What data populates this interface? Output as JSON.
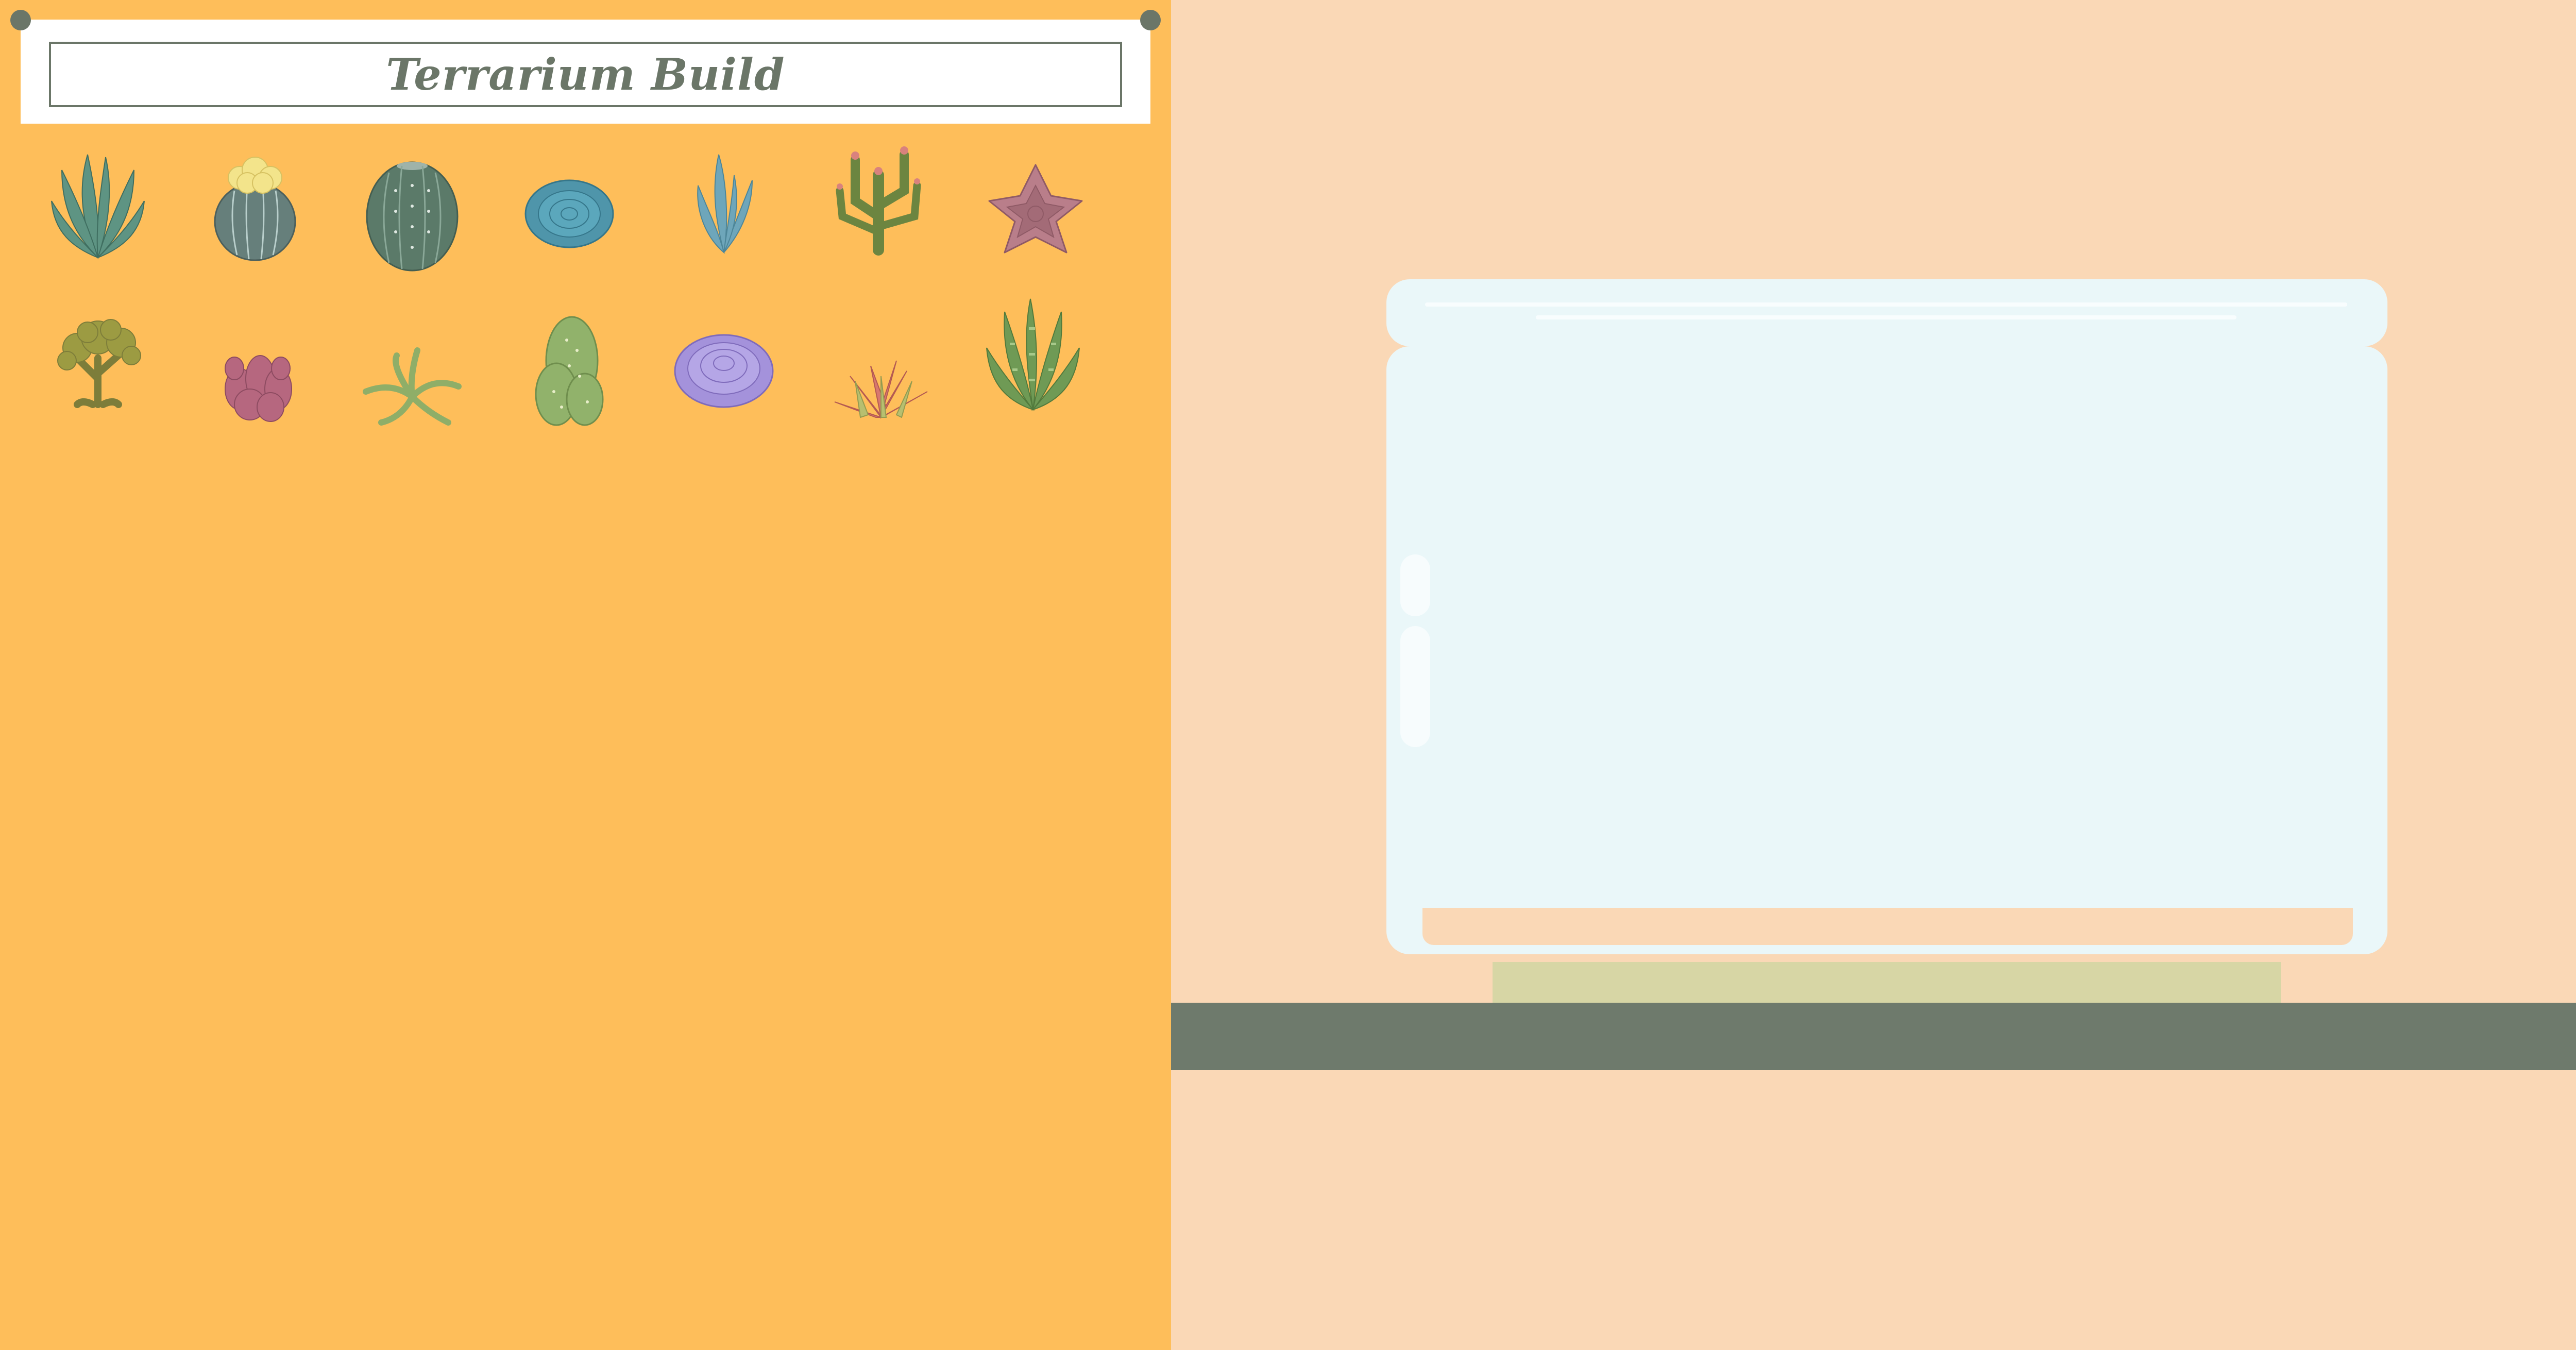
{
  "header": {
    "title": "Terrarium Build"
  },
  "colors": {
    "left_panel": "#FEBE5A",
    "right_panel": "#FAD8B6",
    "title_text": "#6B7668",
    "jar_glass": "#EAF7F9",
    "jar_base": "#D7D6A5",
    "shelf": "#6E7A6C"
  },
  "plants": [
    {
      "id": "plant1",
      "icon": "aloe-icon"
    },
    {
      "id": "plant2",
      "icon": "flowering-barrel-cactus-icon"
    },
    {
      "id": "plant3",
      "icon": "barrel-cactus-icon"
    },
    {
      "id": "plant4",
      "icon": "blue-rosette-succulent-icon"
    },
    {
      "id": "plant5",
      "icon": "blue-finger-succulent-icon"
    },
    {
      "id": "plant6",
      "icon": "branching-cactus-icon"
    },
    {
      "id": "plant7",
      "icon": "pink-echeveria-icon"
    },
    {
      "id": "plant8",
      "icon": "jade-tree-icon"
    },
    {
      "id": "plant9",
      "icon": "pink-coral-succulent-icon"
    },
    {
      "id": "plant10",
      "icon": "trailing-succulent-icon"
    },
    {
      "id": "plant11",
      "icon": "bunny-ear-cactus-icon"
    },
    {
      "id": "plant12",
      "icon": "purple-rosette-succulent-icon"
    },
    {
      "id": "plant13",
      "icon": "red-ice-plant-icon"
    },
    {
      "id": "plant14",
      "icon": "snake-plant-icon"
    }
  ]
}
